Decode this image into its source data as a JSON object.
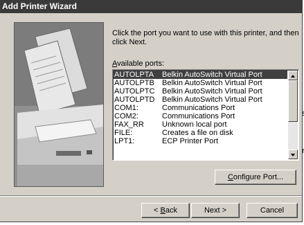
{
  "window": {
    "title": "Add Printer Wizard"
  },
  "instruction": "Click the port you want to use with this printer, and then click Next.",
  "ports_label_prefix": "A",
  "ports_label_rest": "vailable ports:",
  "ports": [
    {
      "port": "AUTOLPTA",
      "description": "Belkin AutoSwitch Virtual Port",
      "selected": true
    },
    {
      "port": "AUTOLPTB",
      "description": "Belkin AutoSwitch Virtual Port",
      "selected": false
    },
    {
      "port": "AUTOLPTC",
      "description": "Belkin AutoSwitch Virtual Port",
      "selected": false
    },
    {
      "port": "AUTOLPTD",
      "description": "Belkin AutoSwitch Virtual Port",
      "selected": false
    },
    {
      "port": "COM1:",
      "description": "Communications Port",
      "selected": false
    },
    {
      "port": "COM2:",
      "description": "Communications Port",
      "selected": false
    },
    {
      "port": "FAX_RR",
      "description": "Unknown local port",
      "selected": false
    },
    {
      "port": "FILE:",
      "description": "Creates a file on disk",
      "selected": false
    },
    {
      "port": "LPT1:",
      "description": "ECP Printer Port",
      "selected": false
    }
  ],
  "buttons": {
    "configure_prefix": "C",
    "configure_rest": "onfigure Port...",
    "back_lead": "< ",
    "back_underline": "B",
    "back_rest": "ack",
    "next": "Next >",
    "cancel": "Cancel"
  },
  "edge_fragments": [
    "s",
    "r"
  ],
  "icons": {
    "scroll_up": "triangle-up",
    "scroll_down": "triangle-down"
  },
  "colors": {
    "titlebar": "#3a3a3a",
    "face": "#d4d0c8",
    "selection": "#404040"
  }
}
